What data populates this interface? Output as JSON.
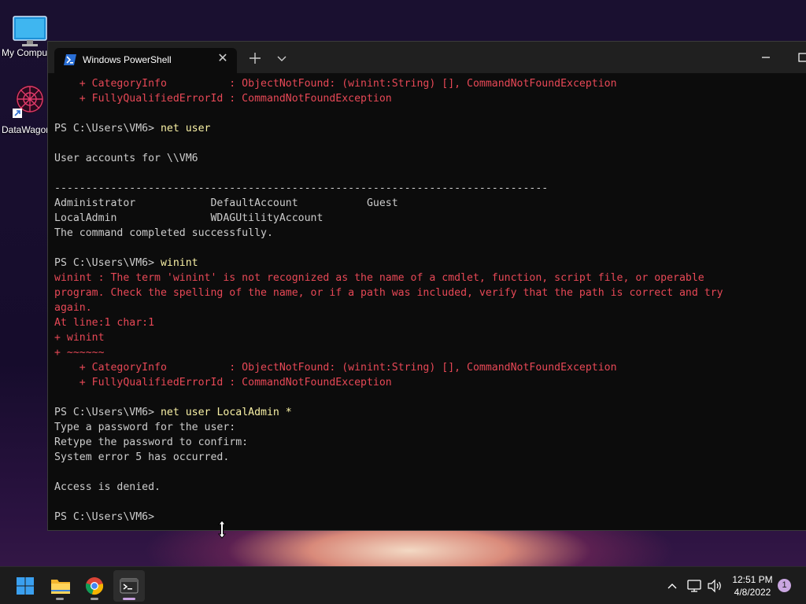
{
  "desktop": {
    "icons": [
      {
        "label": "My Computer",
        "icon": "monitor-icon"
      },
      {
        "label": "DataWagon",
        "icon": "datawagon-app-icon"
      }
    ]
  },
  "window": {
    "tab_title": "Windows PowerShell",
    "tab_icon": "powershell-icon"
  },
  "console": {
    "lines": [
      {
        "text": "    + CategoryInfo          : ObjectNotFound: (winint:String) [], CommandNotFoundException",
        "style": "err"
      },
      {
        "text": "    + FullyQualifiedErrorId : CommandNotFoundException",
        "style": "err"
      },
      {
        "text": "",
        "style": ""
      },
      {
        "prompt": "PS C:\\Users\\VM6> ",
        "cmd": "net user"
      },
      {
        "text": "",
        "style": ""
      },
      {
        "text": "User accounts for \\\\VM6",
        "style": ""
      },
      {
        "text": "",
        "style": ""
      },
      {
        "text": "-------------------------------------------------------------------------------",
        "style": ""
      },
      {
        "text": "Administrator            DefaultAccount           Guest",
        "style": ""
      },
      {
        "text": "LocalAdmin               WDAGUtilityAccount",
        "style": ""
      },
      {
        "text": "The command completed successfully.",
        "style": ""
      },
      {
        "text": "",
        "style": ""
      },
      {
        "prompt": "PS C:\\Users\\VM6> ",
        "cmd": "winint"
      },
      {
        "text": "winint : The term 'winint' is not recognized as the name of a cmdlet, function, script file, or operable",
        "style": "err"
      },
      {
        "text": "program. Check the spelling of the name, or if a path was included, verify that the path is correct and try",
        "style": "err"
      },
      {
        "text": "again.",
        "style": "err"
      },
      {
        "text": "At line:1 char:1",
        "style": "err"
      },
      {
        "text": "+ winint",
        "style": "err"
      },
      {
        "text": "+ ~~~~~~",
        "style": "err"
      },
      {
        "text": "    + CategoryInfo          : ObjectNotFound: (winint:String) [], CommandNotFoundException",
        "style": "err"
      },
      {
        "text": "    + FullyQualifiedErrorId : CommandNotFoundException",
        "style": "err"
      },
      {
        "text": "",
        "style": ""
      },
      {
        "prompt": "PS C:\\Users\\VM6> ",
        "cmd": "net user LocalAdmin *"
      },
      {
        "text": "Type a password for the user:",
        "style": ""
      },
      {
        "text": "Retype the password to confirm:",
        "style": ""
      },
      {
        "text": "System error 5 has occurred.",
        "style": ""
      },
      {
        "text": "",
        "style": ""
      },
      {
        "text": "Access is denied.",
        "style": ""
      },
      {
        "text": "",
        "style": ""
      },
      {
        "prompt": "PS C:\\Users\\VM6> ",
        "cmd": ""
      }
    ]
  },
  "taskbar": {
    "apps": [
      {
        "name": "start-button",
        "icon": "windows-logo-icon"
      },
      {
        "name": "file-explorer-button",
        "icon": "folder-icon"
      },
      {
        "name": "chrome-button",
        "icon": "chrome-icon"
      },
      {
        "name": "terminal-button",
        "icon": "terminal-icon",
        "active": true
      }
    ],
    "tray": {
      "time": "12:51 PM",
      "date": "4/8/2022",
      "notification_count": "1"
    }
  },
  "colors": {
    "error": "#e74856",
    "command": "#f9f1a5",
    "text": "#cccccc",
    "background": "#0c0c0c"
  }
}
